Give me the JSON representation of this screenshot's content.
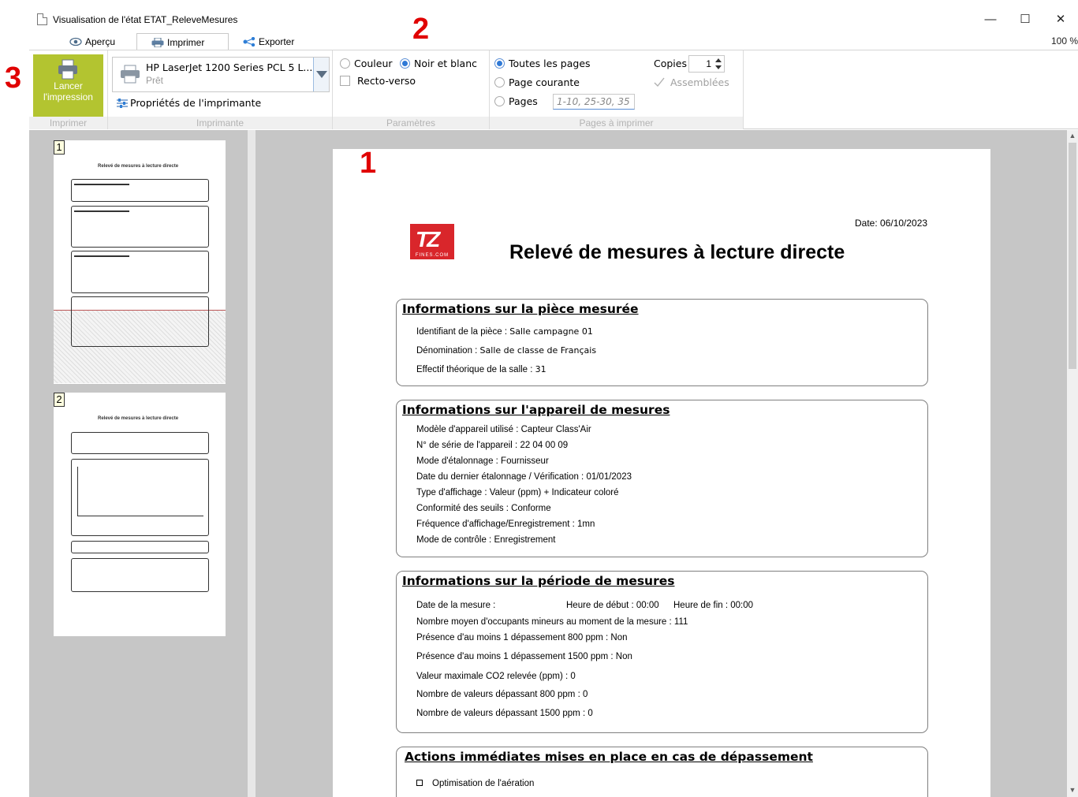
{
  "window": {
    "title": "Visualisation de l'état ETAT_ReleveMesures",
    "controls": {
      "minimize": "—",
      "maximize": "☐",
      "close": "✕"
    }
  },
  "tabs": [
    {
      "label": "Aperçu",
      "icon": "eye-icon"
    },
    {
      "label": "Imprimer",
      "icon": "printer-icon",
      "active": true
    },
    {
      "label": "Exporter",
      "icon": "share-icon"
    }
  ],
  "zoom": "100 %",
  "annotations": {
    "m1": "1",
    "m2": "2",
    "m3": "3",
    "color": "#e00000"
  },
  "ribbon": {
    "print_group": {
      "button_label_line1": "Lancer",
      "button_label_line2": "l'impression",
      "label": "Imprimer"
    },
    "printer_group": {
      "printer_name": "HP LaserJet 1200 Series PCL 5 L...",
      "printer_status": "Prêt",
      "properties_label": "Propriétés de l'imprimante",
      "label": "Imprimante"
    },
    "params_group": {
      "color_label": "Couleur",
      "bw_label": "Noir et blanc",
      "duplex_label": "Recto-verso",
      "selected": "Noir et blanc",
      "label": "Paramètres"
    },
    "pages_group": {
      "all_pages": "Toutes les pages",
      "current_page": "Page courante",
      "pages": "Pages",
      "pages_placeholder": "1-10, 25-30, 35",
      "copies_label": "Copies",
      "copies_value": "1",
      "collate_label": "Assemblées",
      "label": "Pages à imprimer"
    }
  },
  "thumbnails": [
    {
      "number": "1",
      "title": "Relevé de mesures à lecture directe"
    },
    {
      "number": "2",
      "title": "Relevé de mesures à lecture directe"
    }
  ],
  "document": {
    "date": "Date: 06/10/2023",
    "title": "Relevé de mesures à lecture directe",
    "logo_text": "TZ",
    "logo_sub": "FINES.COM",
    "sections": {
      "piece": {
        "title": "Informations sur la pièce mesurée",
        "rows": [
          {
            "label": "Identifiant de la pièce : ",
            "value": "Salle campagne 01"
          },
          {
            "label": "Dénomination : ",
            "value": "Salle de classe de Français"
          },
          {
            "label": "Effectif théorique de la salle : ",
            "value": "31"
          }
        ]
      },
      "appareil": {
        "title": "Informations sur l'appareil de mesures",
        "rows": [
          "Modèle d'appareil utilisé : Capteur Class'Air",
          "N° de série de l'appareil : 22 04 00 09",
          "Mode d'étalonnage : Fournisseur",
          "Date du dernier étalonnage / Vérification : 01/01/2023",
          "Type d'affichage : Valeur (ppm) + Indicateur coloré",
          "Conformité des seuils : Conforme",
          "Fréquence d'affichage/Enregistrement : 1mn",
          "Mode de contrôle : Enregistrement"
        ]
      },
      "periode": {
        "title": "Informations sur la période de mesures",
        "date_label": "Date de la mesure :",
        "start_label": "Heure de début : 00:00",
        "end_label": "Heure de fin : 00:00",
        "rows": [
          "Nombre moyen d'occupants mineurs au moment de la mesure : 111",
          "Présence d'au moins 1 dépassement 800 ppm : Non",
          "Présence d'au moins 1 dépassement 1500 ppm : Non",
          "Valeur maximale CO2 relevée (ppm) : 0",
          "Nombre de valeurs dépassant 800 ppm : 0",
          "Nombre de valeurs dépassant 1500 ppm : 0"
        ]
      },
      "actions": {
        "title": "Actions immédiates mises en place en cas de dépassement",
        "rows": [
          "Optimisation de l'aération"
        ]
      }
    }
  }
}
